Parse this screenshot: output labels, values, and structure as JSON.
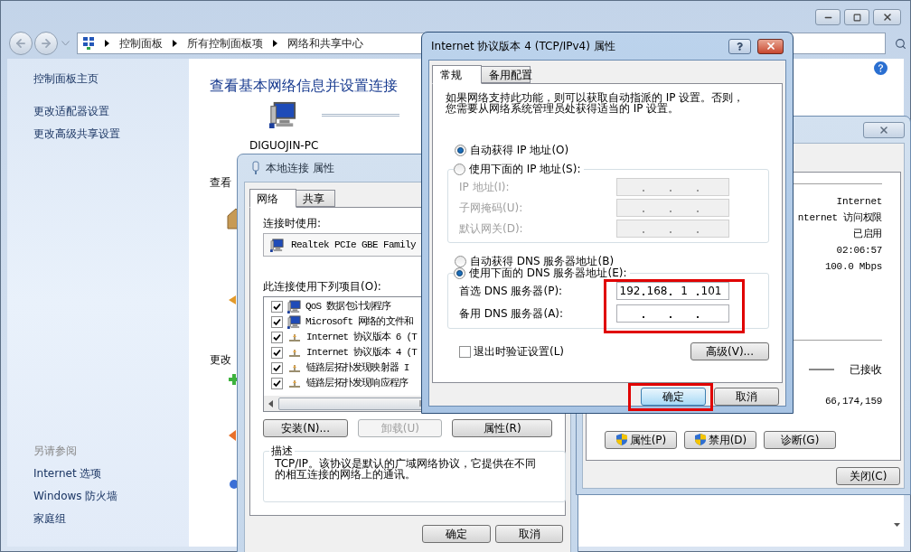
{
  "main_window": {
    "breadcrumb": [
      "控制面板",
      "所有控制面板项",
      "网络和共享中心"
    ],
    "sidebar": {
      "links": [
        "控制面板主页",
        "更改适配器设置",
        "更改高级共享设置"
      ],
      "see_also_heading": "另请参阅",
      "see_also": [
        "Internet 选项",
        "Windows 防火墙",
        "家庭组"
      ]
    },
    "heading": "查看基本网络信息并设置连接",
    "computer_name": "DIGUOJIN-PC",
    "section_labels": [
      "查看",
      "更改"
    ]
  },
  "local_connection_properties": {
    "title": "本地连接 属性",
    "tabs": [
      {
        "label": "网络",
        "selected": true
      },
      {
        "label": "共享",
        "selected": false
      }
    ],
    "connect_using_label": "连接时使用:",
    "adapter": "Realtek PCIe GBE Family",
    "items_label": "此连接使用下列项目(O):",
    "items": [
      {
        "label": "QoS 数据包计划程序",
        "checked": true,
        "kind": "client"
      },
      {
        "label": "Microsoft 网络的文件和",
        "checked": true,
        "kind": "client"
      },
      {
        "label": "Internet 协议版本 6 (T",
        "checked": true,
        "kind": "protocol"
      },
      {
        "label": "Internet 协议版本 4 (T",
        "checked": true,
        "kind": "protocol"
      },
      {
        "label": "链路层拓扑发现映射器 I",
        "checked": true,
        "kind": "protocol"
      },
      {
        "label": "链路层拓扑发现响应程序",
        "checked": true,
        "kind": "protocol"
      }
    ],
    "buttons": [
      {
        "label": "安装(N)...",
        "disabled": false
      },
      {
        "label": "卸载(U)",
        "disabled": true
      },
      {
        "label": "属性(R)",
        "disabled": false
      }
    ],
    "description_heading": "描述",
    "description": [
      "TCP/IP。该协议是默认的广域网络协议，它提供在不同",
      "的相互连接的网络上的通讯。"
    ],
    "footer_buttons": [
      "确定",
      "取消"
    ]
  },
  "status_window": {
    "rows": [
      "Internet",
      "nternet 访问权限",
      "已启用",
      "02:06:57",
      "100.0 Mbps"
    ],
    "received_label": "已接收",
    "received_bytes": "66,174,159",
    "buttons": [
      "属性(P)",
      "禁用(D)",
      "诊断(G)"
    ],
    "close_button": "关闭(C)"
  },
  "ipv4_dialog": {
    "title": "Internet 协议版本 4 (TCP/IPv4) 属性",
    "tabs": [
      {
        "label": "常规",
        "selected": true
      },
      {
        "label": "备用配置",
        "selected": false
      }
    ],
    "intro": [
      "如果网络支持此功能，则可以获取自动指派的 IP 设置。否则，",
      "您需要从网络系统管理员处获得适当的 IP 设置。"
    ],
    "ip_options": [
      {
        "label": "自动获得 IP 地址(O)",
        "selected": true
      },
      {
        "label": "使用下面的 IP 地址(S):",
        "selected": false
      }
    ],
    "ip_fields": [
      {
        "label": "IP 地址(I):",
        "disabled": true
      },
      {
        "label": "子网掩码(U):",
        "disabled": true
      },
      {
        "label": "默认网关(D):",
        "disabled": true
      }
    ],
    "dns_options": [
      {
        "label": "自动获得 DNS 服务器地址(B)",
        "selected": false
      },
      {
        "label": "使用下面的 DNS 服务器地址(E):",
        "selected": true
      }
    ],
    "dns_highlighted": true,
    "dns_fields": [
      {
        "label": "首选 DNS 服务器(P):",
        "disabled": false,
        "octets": [
          "192",
          "168",
          "1",
          "101"
        ]
      },
      {
        "label": "备用 DNS 服务器(A):",
        "disabled": false
      }
    ],
    "validate_checkbox": {
      "label": "退出时验证设置(L)",
      "checked": false
    },
    "advanced_button": "高级(V)...",
    "ok_button": {
      "label": "确定",
      "default": true,
      "highlighted": true
    },
    "cancel_button": "取消"
  }
}
